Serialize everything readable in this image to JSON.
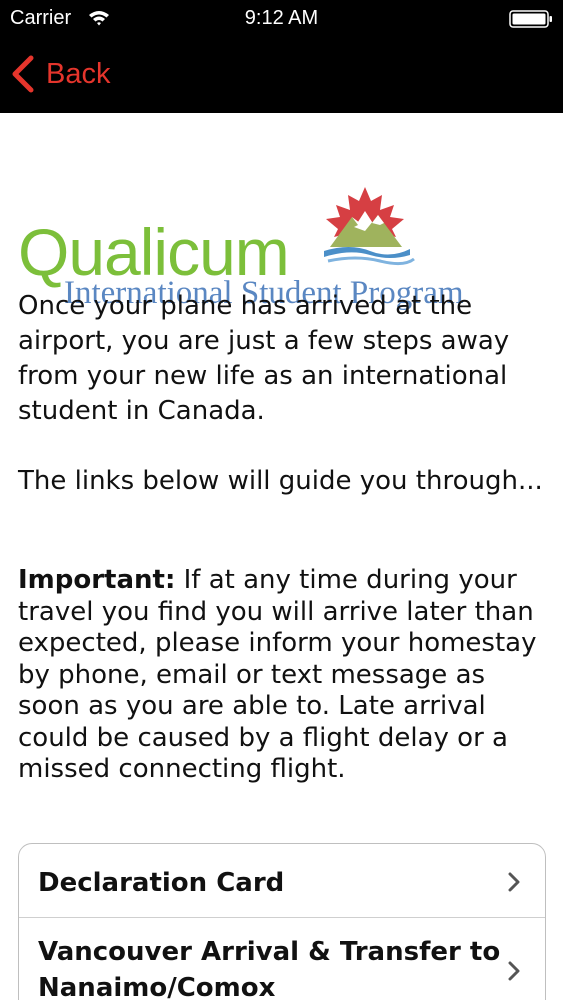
{
  "status_bar": {
    "carrier": "Carrier",
    "time": "9:12 AM",
    "icons": [
      "wifi-icon",
      "battery-icon"
    ]
  },
  "nav": {
    "back_label": "Back",
    "accent_color": "#e5352c"
  },
  "logo": {
    "word": "Qualicum",
    "subtitle": "International Student Program",
    "word_color": "#7cbf3a",
    "subtitle_color": "#5a87c2"
  },
  "content": {
    "para1": "Once your plane has arrived at the airport, you are just a few steps away from your new life as an international student in Canada.",
    "para2": "The links below will guide you through...",
    "important_label": "Important:",
    "important_text": " If at any time during your travel you find you will arrive later than expected, please inform your homestay by phone, email or text message as soon as you are able to. Late arrival could be caused by a flight delay or a missed connecting flight."
  },
  "links": [
    {
      "label": "Declaration Card",
      "icon": "chevron-right-icon"
    },
    {
      "label": "Vancouver Arrival & Transfer to Nanaimo/Comox",
      "icon": "chevron-right-icon"
    }
  ]
}
